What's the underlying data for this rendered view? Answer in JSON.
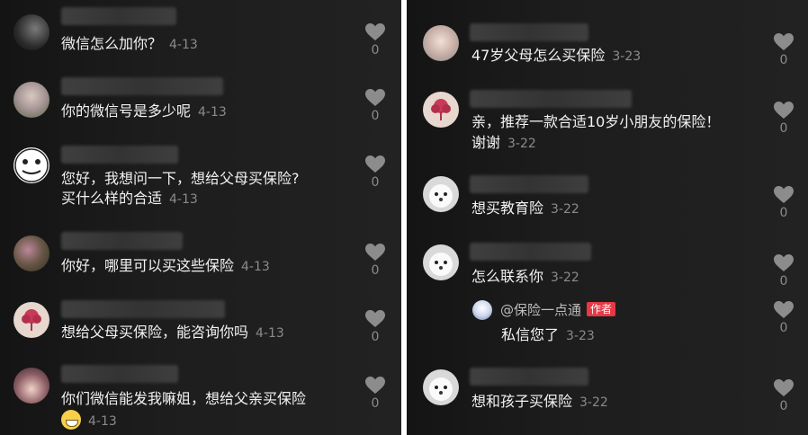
{
  "left": {
    "comments": [
      {
        "text": "微信怎么加你？",
        "time": "4-13",
        "likes": "0"
      },
      {
        "text": "你的微信号是多少呢",
        "time": "4-13",
        "likes": "0"
      },
      {
        "text_line1": "您好，我想问一下，想给父母买保险?",
        "text_line2": "买什么样的合适",
        "time": "4-13",
        "likes": "0"
      },
      {
        "text": "你好，哪里可以买这些保险",
        "time": "4-13",
        "likes": "0"
      },
      {
        "text": "想给父母买保险，能咨询你吗",
        "time": "4-13",
        "likes": "0"
      },
      {
        "text_line1": "你们微信能发我嘛姐，想给父亲买保险",
        "time": "4-13",
        "likes": "0"
      }
    ]
  },
  "right": {
    "comments": [
      {
        "text": "47岁父母怎么买保险",
        "time": "3-23",
        "likes": "0"
      },
      {
        "text_line1": "亲，推荐一款合适10岁小朋友的保险！",
        "text_line2": "谢谢",
        "time": "3-22",
        "likes": "0"
      },
      {
        "text": "想买教育险",
        "time": "3-22",
        "likes": "0"
      },
      {
        "text": "怎么联系你",
        "time": "3-22",
        "likes": "0"
      },
      {
        "text": "想和孩子买保险",
        "time": "3-22",
        "likes": "0"
      }
    ],
    "reply": {
      "name": "@保险一点通",
      "badge": "作者",
      "text": "私信您了",
      "time": "3-23",
      "likes": "0"
    }
  },
  "icons": {
    "like": "heart-icon",
    "emoji": "grin-emoji-icon"
  },
  "colors": {
    "author_badge": "#e53945"
  }
}
